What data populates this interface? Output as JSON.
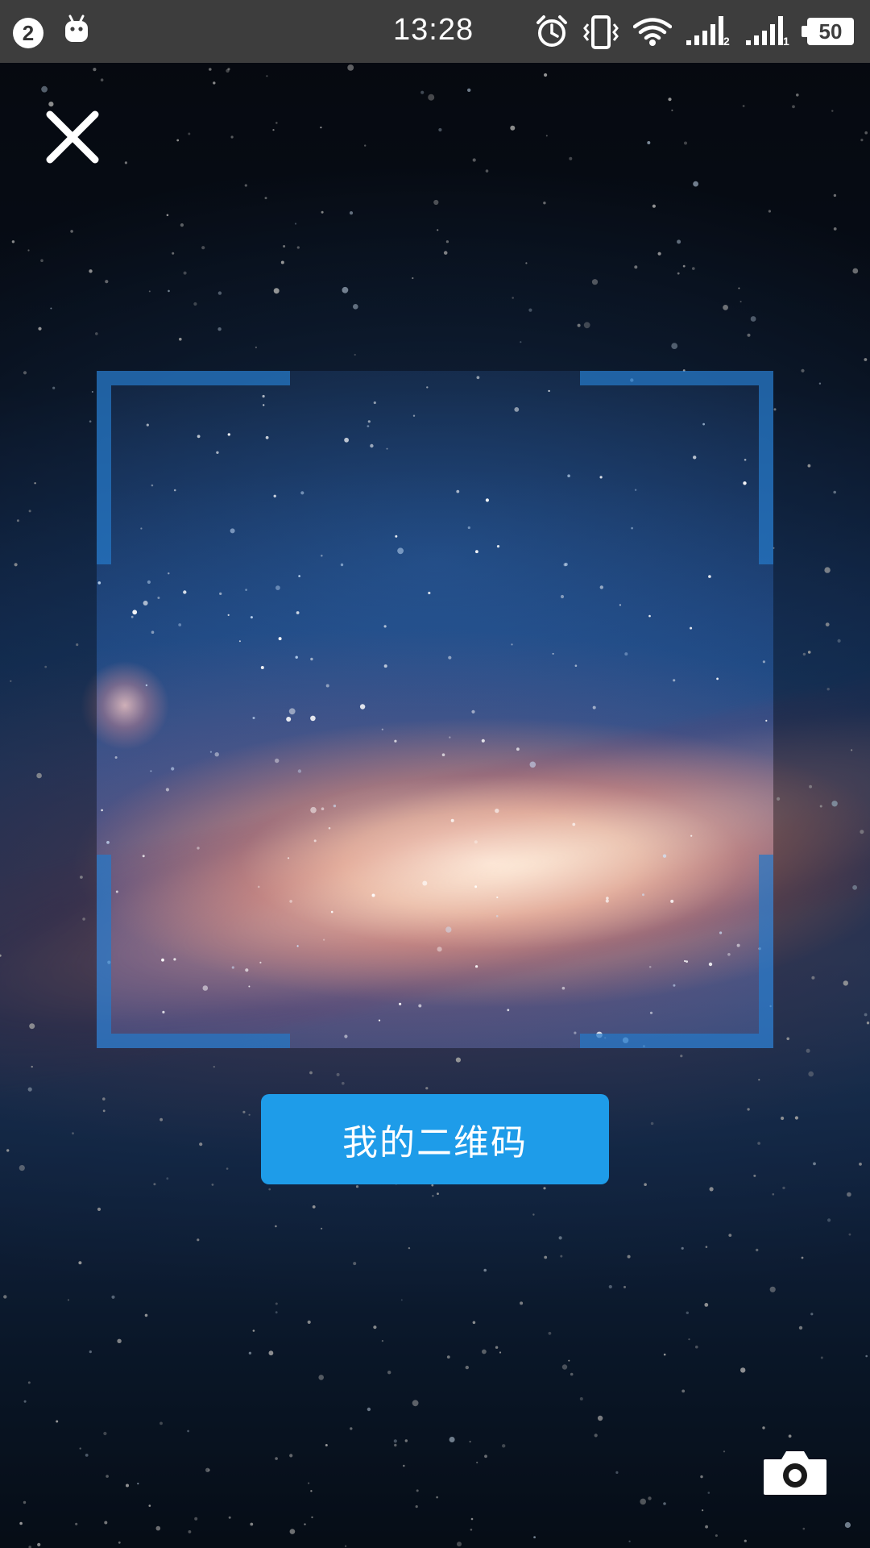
{
  "status_bar": {
    "notification_count": "2",
    "time": "13:28",
    "battery_level": "50",
    "sim1_label": "2",
    "sim2_label": "1",
    "icons": [
      "notification-badge-icon",
      "android-icon",
      "alarm-icon",
      "vibrate-icon",
      "wifi-icon",
      "signal-icon",
      "signal-icon",
      "battery-icon"
    ]
  },
  "scanner": {
    "close_icon": "close-icon",
    "my_qr_label": "我的二维码",
    "camera_icon": "camera-icon",
    "accent_color": "#1e9ce9",
    "frame_color": "#2678c8"
  }
}
